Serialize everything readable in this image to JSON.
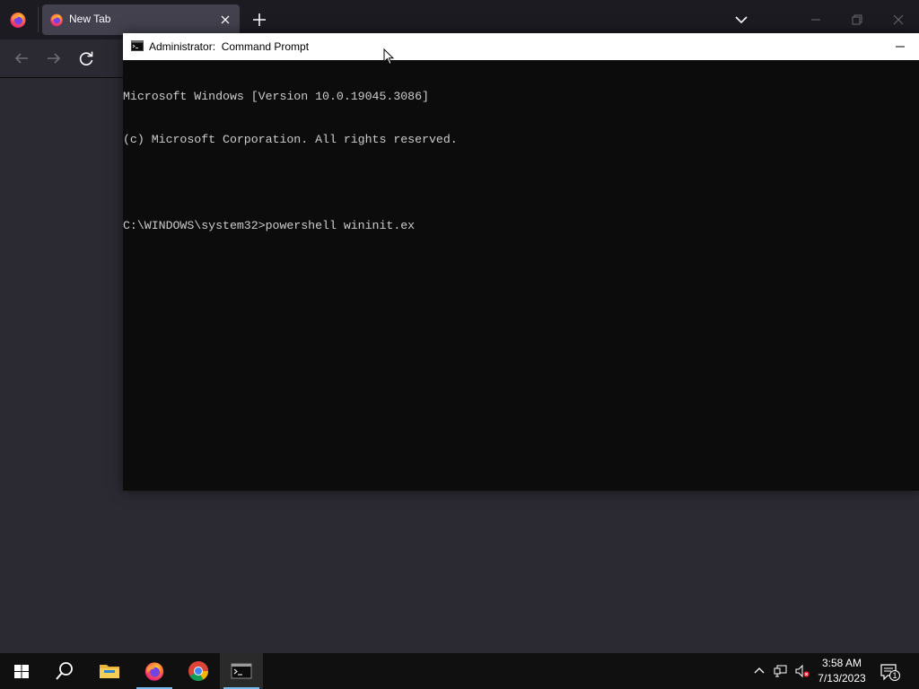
{
  "browser": {
    "tab": {
      "title": "New Tab"
    },
    "icons": {
      "app": "firefox-icon",
      "new_tab": "plus-icon",
      "list_tabs": "chevron-down-icon",
      "back": "arrow-left-icon",
      "forward": "arrow-right-icon",
      "reload": "reload-icon"
    }
  },
  "cmd": {
    "title": "Administrator:  Command Prompt",
    "lines": [
      "Microsoft Windows [Version 10.0.19045.3086]",
      "(c) Microsoft Corporation. All rights reserved.",
      "",
      "C:\\WINDOWS\\system32>powershell wininit.ex"
    ]
  },
  "taskbar": {
    "apps": [
      "start-button",
      "search-button",
      "file-explorer",
      "firefox",
      "chrome",
      "command-prompt"
    ],
    "clock": {
      "time": "3:58 AM",
      "date": "7/13/2023"
    },
    "notification_count": "1"
  }
}
